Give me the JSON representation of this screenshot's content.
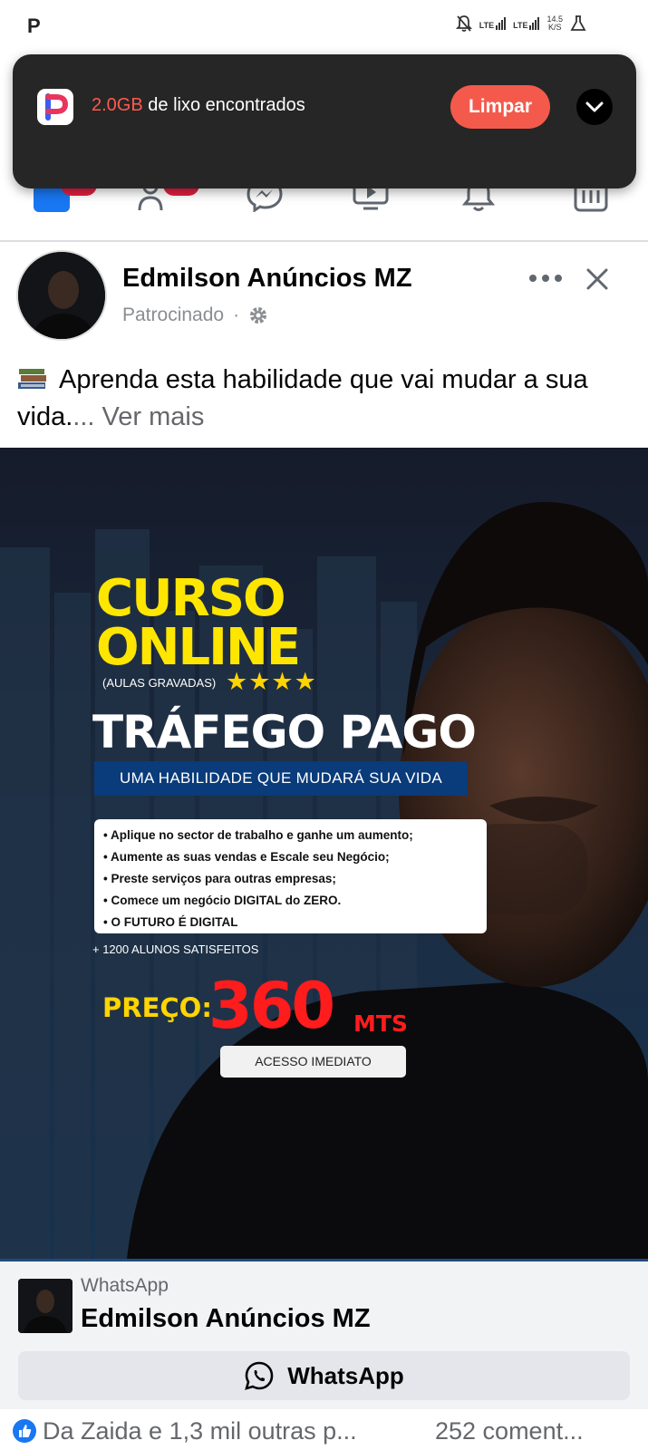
{
  "status_bar": {
    "left_glyph": "P",
    "network_1": "LTE",
    "network_2": "LTE",
    "speed_value": "14.5",
    "speed_unit": "K/S",
    "icons": [
      "notifications-off-icon",
      "signal-icon",
      "signal-icon",
      "flask-icon"
    ]
  },
  "notification": {
    "amount": "2.0GB",
    "message": " de lixo encontrados",
    "button_label": "Limpar",
    "accent": "#f45a4c",
    "icons": [
      "cleaner-app-icon",
      "chevron-down-icon"
    ]
  },
  "fb_nav": {
    "icons": [
      "home-icon",
      "friends-icon",
      "messenger-icon",
      "video-icon",
      "bell-icon",
      "marketplace-icon"
    ]
  },
  "post": {
    "page_name": "Edmilson Anúncios MZ",
    "sponsored": "Patrocinado",
    "separator": "·",
    "text": "Aprenda esta habilidade que vai mudar a sua vida.",
    "ellipsis": "...",
    "see_more": "Ver mais",
    "icons": [
      "more-options-icon",
      "close-icon",
      "gear-icon",
      "books-emoji-icon"
    ]
  },
  "ad_creative": {
    "line1": "CURSO",
    "line2": "ONLINE",
    "subtitle": "(AULAS GRAVADAS)",
    "stars": "★★★★",
    "rating_stars": 4,
    "headline": "TRÁFEGO PAGO",
    "tagline": "UMA HABILIDADE QUE MUDARÁ SUA VIDA",
    "bullets": [
      "• Aplique no sector de trabalho e ganhe um aumento;",
      "• Aumente as suas vendas e Escale seu Negócio;",
      "• Preste serviços para outras empresas;",
      "• Comece um negócio DIGITAL do ZERO.",
      "• O FUTURO É DIGITAL"
    ],
    "students": "+ 1200 ALUNOS SATISFEITOS",
    "price_label": "PREÇO:",
    "price_value": "360",
    "currency": "MTS",
    "access": "ACESSO IMEDIATO",
    "colors": {
      "yellow": "#ffe600",
      "red": "#ff1c1c",
      "band": "#0a3b7a"
    }
  },
  "cta": {
    "source": "WhatsApp",
    "title": "Edmilson Anúncios MZ",
    "button_label": "WhatsApp",
    "icons": [
      "whatsapp-icon"
    ]
  },
  "reactions": {
    "text": "Da Zaida e 1,3 mil outras p...",
    "comments": "252 coment...",
    "icons": [
      "like-icon"
    ]
  }
}
